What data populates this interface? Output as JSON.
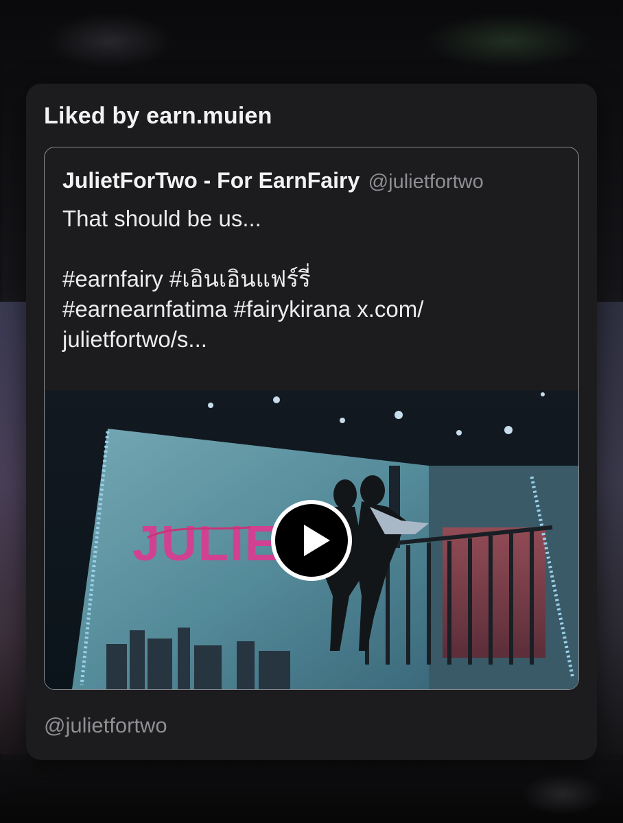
{
  "card": {
    "liked_by": "Liked by earn.muien"
  },
  "tweet": {
    "author_name": "JulietForTwo - For EarnFairy",
    "author_handle": "@julietfortwo",
    "text_lines": [
      "That should be us...",
      "",
      "#earnfairy #เอินเอินแฟร์รี่",
      "#earnearnfatima #fairykirana x.com/",
      "julietfortwo/s..."
    ],
    "media": {
      "type": "video",
      "poster_text": "JULIE",
      "play_icon": "play-icon"
    }
  },
  "footer": {
    "handle": "@julietfortwo"
  },
  "colors": {
    "card_bg": "#1c1c1e",
    "text_primary": "#f2f2f4",
    "text_secondary": "#8e8e93",
    "poster_accent": "#e0409a"
  }
}
